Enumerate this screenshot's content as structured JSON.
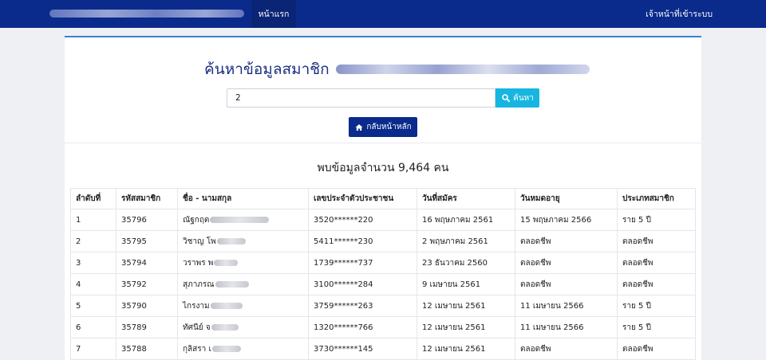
{
  "navbar": {
    "home_label": "หน้าแรก",
    "staff_label": "เจ้าหน้าที่เข้าระบบ"
  },
  "page": {
    "title": "ค้นหาข้อมูลสมาชิก"
  },
  "search": {
    "value": "2",
    "button_label": "ค้นหา",
    "back_label": "กลับหน้าหลัก"
  },
  "result": {
    "summary": "พบข้อมูลจำนวน 9,464 คน"
  },
  "table": {
    "headers": [
      "ลำดับที่",
      "รหัสสมาชิก",
      "ชื่อ - นามสกุล",
      "เลขประจำตัวประชาชน",
      "วันที่สมัคร",
      "วันหมดอายุ",
      "ประเภทสมาชิก"
    ],
    "rows": [
      {
        "no": "1",
        "member_id": "35796",
        "name": "ณัฐกฤต",
        "citizen_id": "3520******220",
        "register_date": "16 พฤษภาคม 2561",
        "expire_date": "15 พฤษภาคม 2566",
        "type": "ราย 5 ปี"
      },
      {
        "no": "2",
        "member_id": "35795",
        "name": "วิชาญ โพ",
        "citizen_id": "5411******230",
        "register_date": "2 พฤษภาคม 2561",
        "expire_date": "ตลอดชีพ",
        "type": "ตลอดชีพ"
      },
      {
        "no": "3",
        "member_id": "35794",
        "name": "วราพร พ",
        "citizen_id": "1739******737",
        "register_date": "23 ธันวาคม 2560",
        "expire_date": "ตลอดชีพ",
        "type": "ตลอดชีพ"
      },
      {
        "no": "4",
        "member_id": "35792",
        "name": "สุภาภรณ",
        "citizen_id": "3100******284",
        "register_date": "9 เมษายน 2561",
        "expire_date": "ตลอดชีพ",
        "type": "ตลอดชีพ"
      },
      {
        "no": "5",
        "member_id": "35790",
        "name": "ไกรงาม",
        "citizen_id": "3759******263",
        "register_date": "12 เมษายน 2561",
        "expire_date": "11 เมษายน 2566",
        "type": "ราย 5 ปี"
      },
      {
        "no": "6",
        "member_id": "35789",
        "name": "ทัศนีย์ จ",
        "citizen_id": "1320******766",
        "register_date": "12 เมษายน 2561",
        "expire_date": "11 เมษายน 2566",
        "type": "ราย 5 ปี"
      },
      {
        "no": "7",
        "member_id": "35788",
        "name": "กุลิสรา เ",
        "citizen_id": "3730******145",
        "register_date": "12 เมษายน 2561",
        "expire_date": "ตลอดชีพ",
        "type": "ตลอดชีพ"
      }
    ]
  },
  "colors": {
    "navbar": "#0a2a8c",
    "accent_button": "#17b6e0",
    "title": "#1a2f80"
  },
  "icons": {
    "search_button": "search-icon",
    "back_button": "home-icon"
  }
}
